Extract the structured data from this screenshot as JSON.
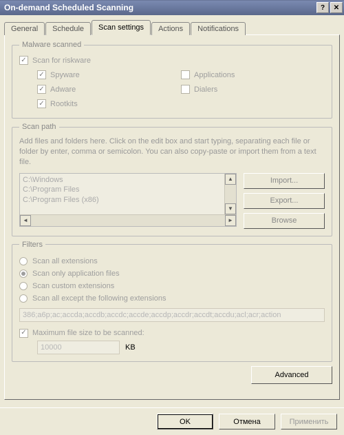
{
  "window": {
    "title": "On-demand Scheduled Scanning"
  },
  "tabs": {
    "general": "General",
    "schedule": "Schedule",
    "scan_settings": "Scan settings",
    "actions": "Actions",
    "notifications": "Notifications"
  },
  "malware": {
    "legend": "Malware scanned",
    "riskware": "Scan for riskware",
    "spyware": "Spyware",
    "adware": "Adware",
    "rootkits": "Rootkits",
    "applications": "Applications",
    "dialers": "Dialers"
  },
  "scanpath": {
    "legend": "Scan path",
    "hint": "Add files and folders here. Click on the edit box and start typing, separating each file or folder by enter, comma or semicolon. You can also copy-paste or import them from a text file.",
    "paths": [
      "C:\\Windows",
      "C:\\Program Files",
      "C:\\Program Files (x86)"
    ],
    "import": "Import...",
    "export": "Export...",
    "browse": "Browse"
  },
  "filters": {
    "legend": "Filters",
    "opt_all": "Scan all extensions",
    "opt_apps": "Scan only application files",
    "opt_custom": "Scan custom extensions",
    "opt_except": "Scan all except the following extensions",
    "ext_value": "386;a6p;ac;accda;accdb;accdc;accde;accdp;accdr;accdt;accdu;acl;acr;action",
    "max_label": "Maximum file size to be scanned:",
    "size_value": "10000",
    "size_unit": "KB"
  },
  "advanced": "Advanced",
  "footer": {
    "ok": "OK",
    "cancel": "Отмена",
    "apply": "Применить"
  }
}
